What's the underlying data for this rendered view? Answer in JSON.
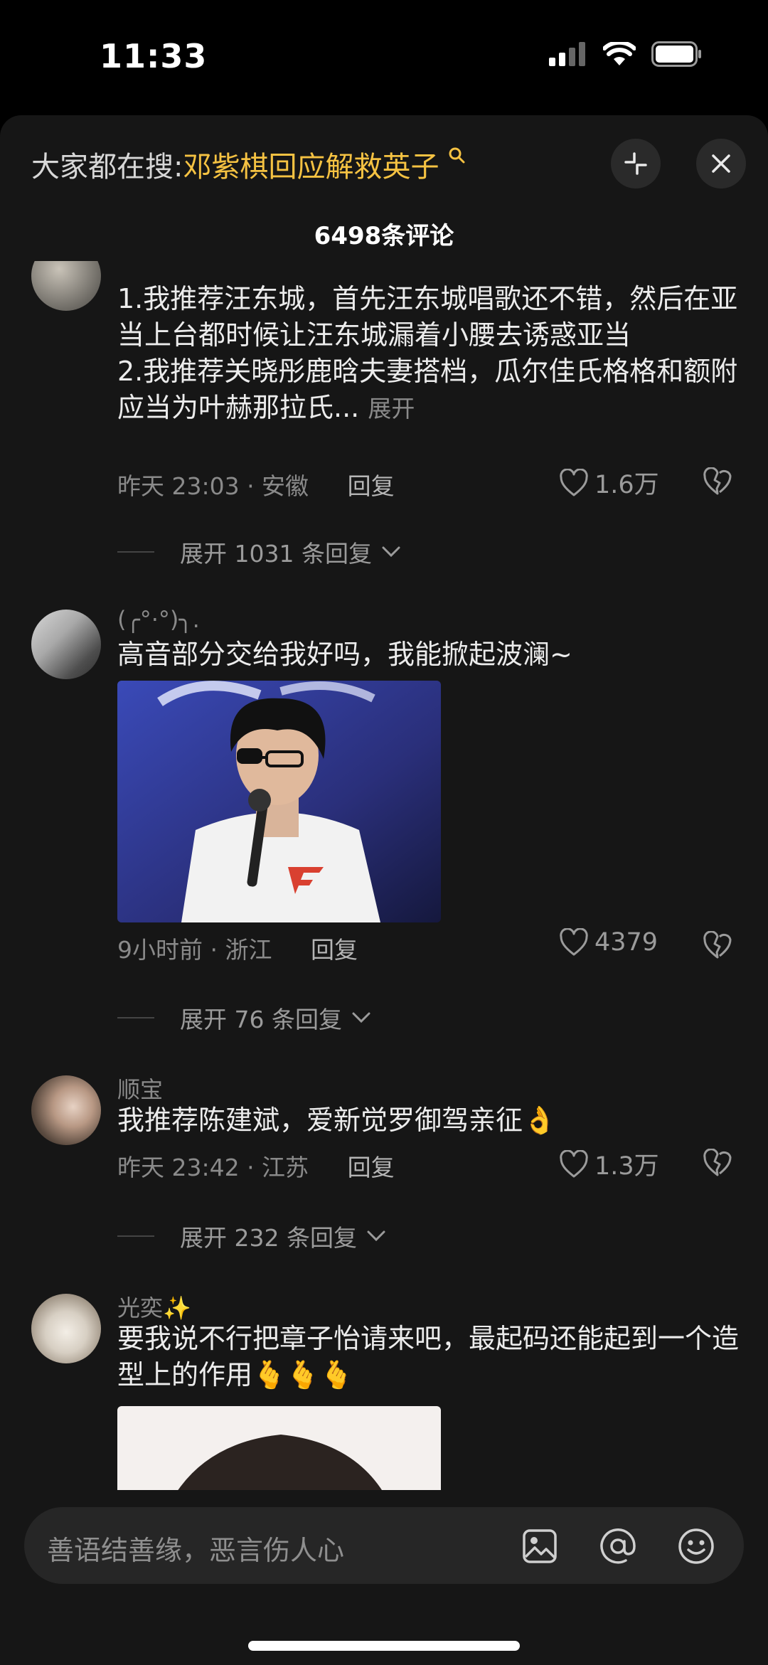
{
  "status": {
    "time": "11:33"
  },
  "header": {
    "search_label": "大家都在搜:",
    "search_keyword": "邓紫棋回应解救英子",
    "comment_count": "6498条评论"
  },
  "comments": [
    {
      "text": "1.我推荐汪东城，首先汪东城唱歌还不错，然后在亚当上台都时候让汪东城漏着小腰去诱惑亚当\n2.我推荐关晓彤鹿晗夫妻搭档，瓜尔佳氏格格和额附应当为叶赫那拉氏...",
      "expand_label": "展开",
      "time_loc": "昨天 23:03 · 安徽",
      "reply_label": "回复",
      "likes": "1.6万",
      "more_replies": "展开 1031 条回复"
    },
    {
      "username": "(╭°·°)╮.",
      "text": "高音部分交给我好吗，我能掀起波澜~",
      "time_loc": "9小时前 · 浙江",
      "reply_label": "回复",
      "likes": "4379",
      "more_replies": "展开 76 条回复"
    },
    {
      "username": "顺宝",
      "text": "我推荐陈建斌，爱新觉罗御驾亲征👌",
      "time_loc": "昨天 23:42 · 江苏",
      "reply_label": "回复",
      "likes": "1.3万",
      "more_replies": "展开 232 条回复"
    },
    {
      "username": "光奕✨",
      "text": "要我说不行把章子怡请来吧，最起码还能起到一个造型上的作用🫰🫰🫰"
    }
  ],
  "input": {
    "placeholder": "善语结善缘，恶言伤人心"
  },
  "icons": [
    "signal-icon",
    "wifi-icon",
    "battery-icon",
    "search-icon",
    "collapse-icon",
    "close-icon",
    "heart-icon",
    "broken-heart-icon",
    "chevron-down-icon",
    "image-icon",
    "at-icon",
    "emoji-icon"
  ]
}
